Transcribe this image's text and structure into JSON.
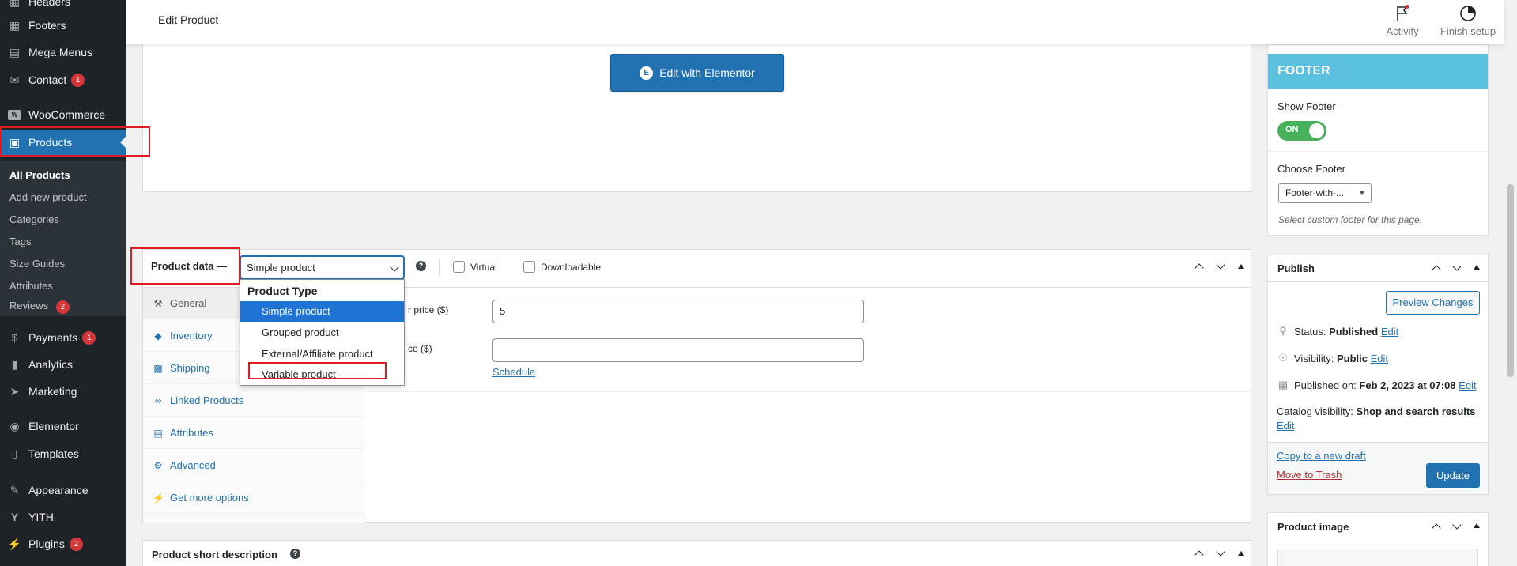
{
  "sidebar": {
    "items": [
      {
        "label": "Headers",
        "icon": "layout-icon",
        "badge": ""
      },
      {
        "label": "Footers",
        "icon": "layout-icon",
        "badge": ""
      },
      {
        "label": "Mega Menus",
        "icon": "table-icon",
        "badge": ""
      },
      {
        "label": "Contact",
        "icon": "mail-icon",
        "badge": "1"
      },
      {
        "label": "WooCommerce",
        "icon": "woo-icon",
        "badge": ""
      },
      {
        "label": "Products",
        "icon": "archive-icon",
        "badge": ""
      },
      {
        "label": "Payments",
        "icon": "dollar-icon",
        "badge": "1"
      },
      {
        "label": "Analytics",
        "icon": "bar-chart-icon",
        "badge": ""
      },
      {
        "label": "Marketing",
        "icon": "megaphone-icon",
        "badge": ""
      },
      {
        "label": "Elementor",
        "icon": "elementor-icon",
        "badge": ""
      },
      {
        "label": "Templates",
        "icon": "folder-icon",
        "badge": ""
      },
      {
        "label": "Appearance",
        "icon": "brush-icon",
        "badge": ""
      },
      {
        "label": "YITH",
        "icon": "yith-icon",
        "badge": ""
      },
      {
        "label": "Plugins",
        "icon": "plug-icon",
        "badge": "2"
      }
    ],
    "submenu": [
      {
        "label": "All Products"
      },
      {
        "label": "Add new product"
      },
      {
        "label": "Categories"
      },
      {
        "label": "Tags"
      },
      {
        "label": "Size Guides"
      },
      {
        "label": "Attributes"
      },
      {
        "label": "Reviews",
        "badge": "2"
      }
    ]
  },
  "topbar": {
    "title": "Edit Product",
    "activity": "Activity",
    "finish_setup": "Finish setup"
  },
  "main": {
    "elementor_button": "Edit with Elementor",
    "product_data": {
      "title": "Product data —",
      "type_selected": "Simple product",
      "virtual_label": "Virtual",
      "downloadable_label": "Downloadable",
      "tabs": [
        {
          "label": "General",
          "icon": "wrench-icon"
        },
        {
          "label": "Inventory",
          "icon": "tag-icon"
        },
        {
          "label": "Shipping",
          "icon": "truck-icon"
        },
        {
          "label": "Linked Products",
          "icon": "link-icon"
        },
        {
          "label": "Attributes",
          "icon": "list-icon"
        },
        {
          "label": "Advanced",
          "icon": "gear-icon"
        },
        {
          "label": "Get more options",
          "icon": "plug-icon"
        }
      ],
      "regular_price_label": "r price ($)",
      "regular_price_value": "5",
      "sale_price_label": "ce ($)",
      "sale_price_value": "",
      "schedule_link": "Schedule",
      "dropdown": {
        "group_label": "Product Type",
        "options": [
          "Simple product",
          "Grouped product",
          "External/Affiliate product",
          "Variable product"
        ]
      }
    },
    "short_description_title": "Product short description"
  },
  "right": {
    "footer_box": {
      "banner": "FOOTER",
      "show_footer_label": "Show Footer",
      "toggle_text": "ON",
      "choose_footer_label": "Choose Footer",
      "footer_select_value": "Footer-with-...",
      "description": "Select custom footer for this page."
    },
    "publish": {
      "title": "Publish",
      "preview_button": "Preview Changes",
      "status_label": "Status:",
      "status_value": "Published",
      "visibility_label": "Visibility:",
      "visibility_value": "Public",
      "published_label": "Published on:",
      "published_value": "Feb 2, 2023 at 07:08",
      "catalog_label": "Catalog visibility:",
      "catalog_value": "Shop and search results",
      "edit_link": "Edit",
      "copy_draft": "Copy to a new draft",
      "move_trash": "Move to Trash",
      "update_button": "Update"
    },
    "product_image_title": "Product image"
  },
  "colors": {
    "sidebar_bg": "#1d2327",
    "accent": "#2271b1",
    "footer_banner": "#5bc0de",
    "toggle_on": "#47b05b",
    "badge": "#d63638",
    "highlight": "#e01b24",
    "trash_link": "#b32d2e"
  }
}
